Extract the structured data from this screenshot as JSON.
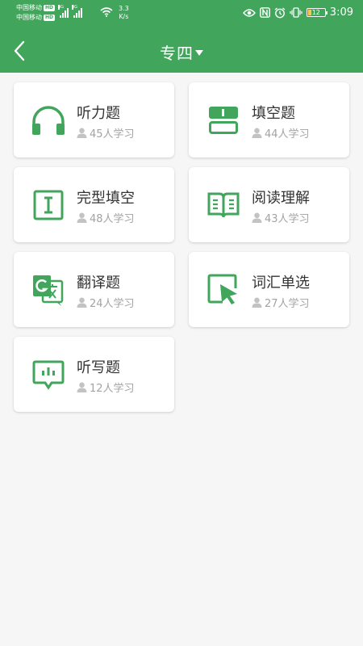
{
  "status_bar": {
    "carrier1": "中国移动",
    "carrier2": "中国移动",
    "hd": "HD",
    "net1": "4G",
    "net2": "4G",
    "speed_value": "3.3",
    "speed_unit": "K/s",
    "battery": "12",
    "time": "3:09"
  },
  "header": {
    "title": "专四",
    "accent": "#41a55c"
  },
  "cards": [
    {
      "label": "听力题",
      "count": "45人学习",
      "icon": "headphones-icon"
    },
    {
      "label": "填空题",
      "count": "44人学习",
      "icon": "fill-blank-icon"
    },
    {
      "label": "完型填空",
      "count": "48人学习",
      "icon": "text-cursor-icon"
    },
    {
      "label": "阅读理解",
      "count": "43人学习",
      "icon": "open-book-icon"
    },
    {
      "label": "翻译题",
      "count": "24人学习",
      "icon": "translate-icon"
    },
    {
      "label": "词汇单选",
      "count": "27人学习",
      "icon": "pointer-select-icon"
    },
    {
      "label": "听写题",
      "count": "12人学习",
      "icon": "dictation-icon"
    }
  ]
}
